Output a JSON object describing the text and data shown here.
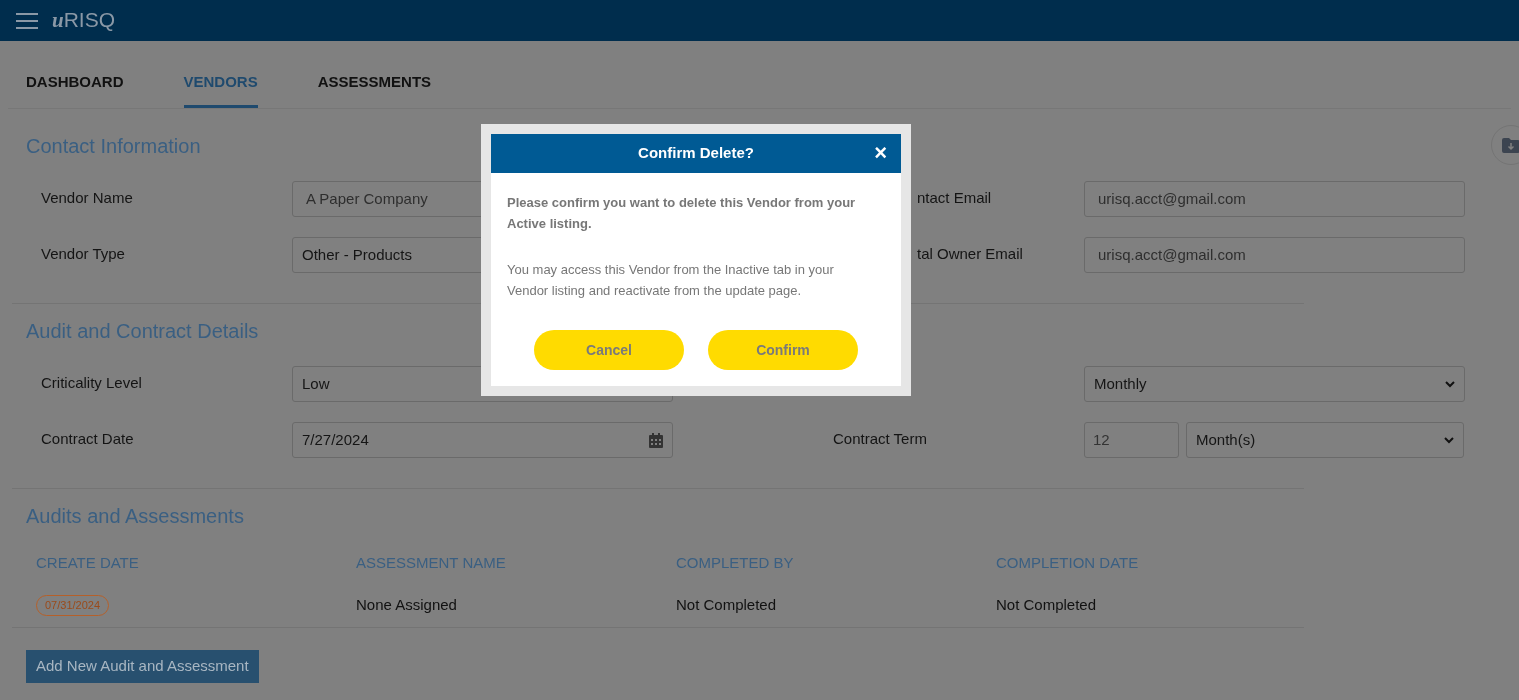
{
  "header": {
    "logo": "uRISQ"
  },
  "tabs": [
    {
      "label": "DASHBOARD",
      "selected": false
    },
    {
      "label": "VENDORS",
      "selected": true
    },
    {
      "label": "ASSESSMENTS",
      "selected": false
    }
  ],
  "contact_section": {
    "title": "Contact Information",
    "rows": [
      {
        "left": {
          "label": "Vendor Name",
          "kind": "text",
          "value": "A Paper Company"
        },
        "right": {
          "label": "ntact Email",
          "kind": "text",
          "value": "urisq.acct@gmail.com"
        }
      },
      {
        "left": {
          "label": "Vendor Type",
          "kind": "select",
          "value": "Other - Products"
        },
        "right": {
          "label": "tal Owner Email",
          "kind": "text",
          "value": "urisq.acct@gmail.com"
        }
      }
    ]
  },
  "audit_section": {
    "title": "Audit and Contract Details",
    "rows": [
      {
        "left": {
          "label": "Criticality Level",
          "kind": "select",
          "value": "Low"
        },
        "right": {
          "kind": "select",
          "value": "Monthly"
        }
      },
      {
        "left": {
          "label": "Contract Date",
          "kind": "date",
          "value": "7/27/2024"
        },
        "right": {
          "label": "Contract Term",
          "kind": "term",
          "value": "12",
          "unit": "Month(s)"
        }
      }
    ]
  },
  "assessments": {
    "title": "Audits and Assessments",
    "columns": [
      "CREATE DATE",
      "ASSESSMENT NAME",
      "COMPLETED BY",
      "COMPLETION DATE"
    ],
    "rows": [
      {
        "create_date": "07/31/2024",
        "assessment_name": "None Assigned",
        "completed_by": "Not Completed",
        "completion_date": "Not Completed"
      }
    ],
    "add_button": "Add New Audit and Assessment"
  },
  "dialog": {
    "title": "Confirm Delete?",
    "close": "×",
    "message": "Please confirm you want to delete this Vendor from your Active listing.",
    "note": "You may access this Vendor from the Inactive tab in your Vendor listing and reactivate from the update page.",
    "buttons": [
      "Cancel",
      "Confirm"
    ]
  }
}
